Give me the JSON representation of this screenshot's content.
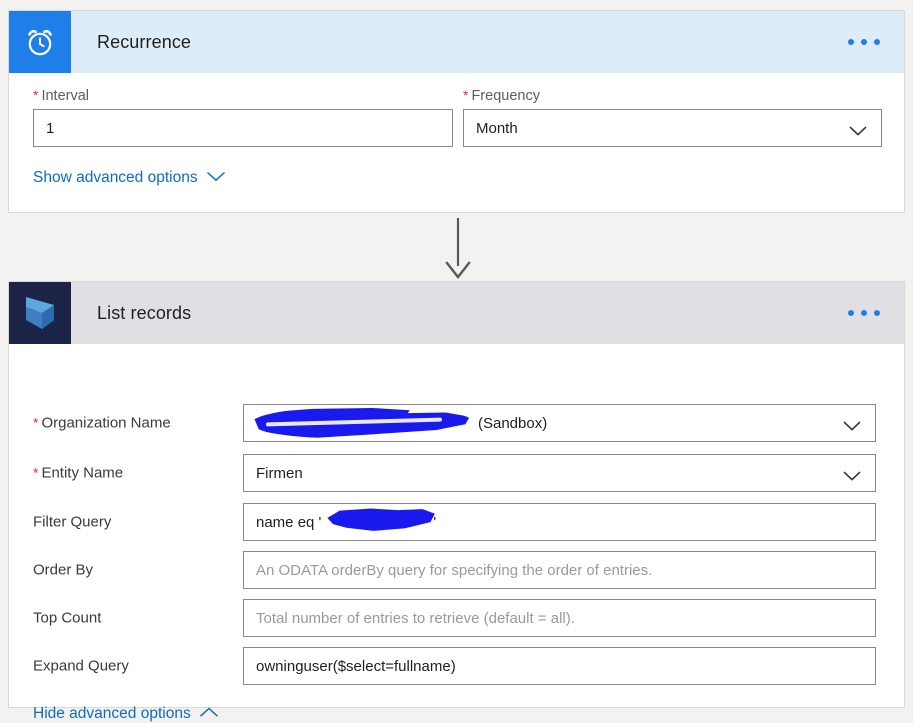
{
  "page": {
    "background_color": "#f3f2f1",
    "accent_color": "#0f6cbd",
    "required_marker": "*",
    "redaction_color": "#1a1aee"
  },
  "recurrence_card": {
    "icon_name": "alarm-clock-icon",
    "icon_background": "#1f7fe8",
    "header_background": "#dcecf9",
    "title": "Recurrence",
    "overflow_menu_label": "...",
    "fields": {
      "interval": {
        "label": "Interval",
        "required": true,
        "value": "1"
      },
      "frequency": {
        "label": "Frequency",
        "required": true,
        "value": "Month",
        "type": "dropdown"
      }
    },
    "advanced_toggle": {
      "label": "Show advanced options",
      "chevron": "chevron-down"
    }
  },
  "connector": {
    "direction": "down",
    "name": "flow-arrow"
  },
  "list_records_card": {
    "icon_name": "dynamics-365-icon",
    "icon_background": "#1b2447",
    "header_background": "#dfdfe4",
    "title": "List records",
    "overflow_menu_label": "...",
    "fields": [
      {
        "label": "Organization Name",
        "required": true,
        "type": "dropdown",
        "value_redacted": true,
        "value_suffix": "(Sandbox)",
        "placeholder": ""
      },
      {
        "label": "Entity Name",
        "required": true,
        "type": "dropdown",
        "value": "Firmen",
        "placeholder": ""
      },
      {
        "label": "Filter Query",
        "required": false,
        "type": "text",
        "value_prefix": "name eq '",
        "value_redacted": true,
        "value_suffix": "'",
        "placeholder": ""
      },
      {
        "label": "Order By",
        "required": false,
        "type": "text",
        "value": "",
        "placeholder": "An ODATA orderBy query for specifying the order of entries."
      },
      {
        "label": "Top Count",
        "required": false,
        "type": "text",
        "value": "",
        "placeholder": "Total number of entries to retrieve (default = all)."
      },
      {
        "label": "Expand Query",
        "required": false,
        "type": "text",
        "value": "owninguser($select=fullname)",
        "placeholder": ""
      }
    ],
    "advanced_toggle": {
      "label": "Hide advanced options",
      "chevron": "chevron-up"
    }
  }
}
